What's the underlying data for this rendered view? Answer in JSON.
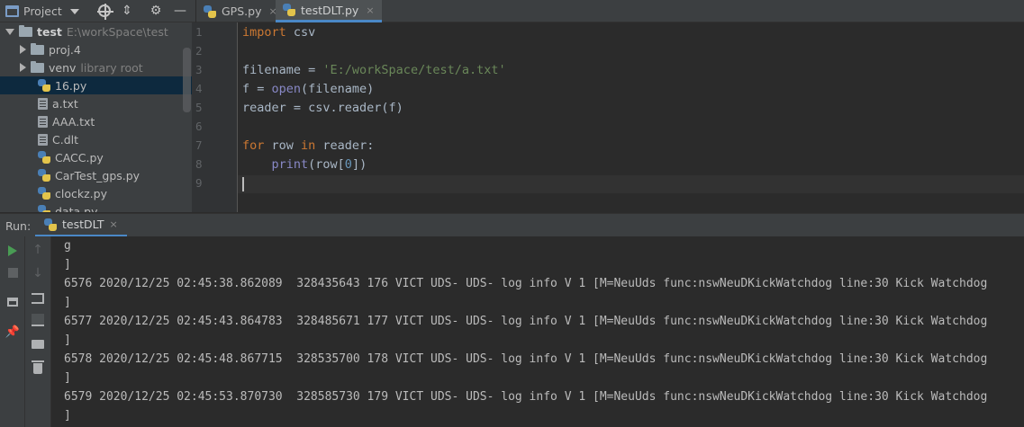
{
  "toolbar": {
    "project_label": "Project",
    "tabs": [
      {
        "label": "GPS.py",
        "close": "×"
      },
      {
        "label": "testDLT.py",
        "close": "×"
      }
    ]
  },
  "tree": {
    "root": {
      "name": "test",
      "path": "E:\\workSpace\\test"
    },
    "items": [
      {
        "name": "proj.4",
        "note": ""
      },
      {
        "name": "venv",
        "note": "library root"
      },
      {
        "name": "16.py",
        "note": ""
      },
      {
        "name": "a.txt",
        "note": ""
      },
      {
        "name": "AAA.txt",
        "note": ""
      },
      {
        "name": "C.dlt",
        "note": ""
      },
      {
        "name": "CACC.py",
        "note": ""
      },
      {
        "name": "CarTest_gps.py",
        "note": ""
      },
      {
        "name": "clockz.py",
        "note": ""
      },
      {
        "name": "data.py",
        "note": ""
      }
    ]
  },
  "editor": {
    "line_numbers": [
      "1",
      "2",
      "3",
      "4",
      "5",
      "6",
      "7",
      "8",
      "9"
    ],
    "code": {
      "l1_kw": "import",
      "l1_rest": " csv",
      "l3_lhs": "filename = ",
      "l3_str": "'E:/workSpace/test/a.txt'",
      "l4_lhs": "f = ",
      "l4_fn": "open",
      "l4_rest": "(filename)",
      "l5": "reader = csv.reader(f)",
      "l7_for": "for",
      "l7_mid": " row ",
      "l7_in": "in",
      "l7_rest": " reader:",
      "l8_indent": "    ",
      "l8_fn": "print",
      "l8_a": "(row[",
      "l8_num": "0",
      "l8_b": "])"
    }
  },
  "run": {
    "label": "Run:",
    "tab_label": "testDLT",
    "tab_close": "×",
    "console_lines": [
      "g",
      "]",
      "6576 2020/12/25 02:45:38.862089  328435643 176 VICT UDS- UDS- log info V 1 [M=NeuUds func:nswNeuDKickWatchdog line:30 Kick Watchdog",
      "]",
      "6577 2020/12/25 02:45:43.864783  328485671 177 VICT UDS- UDS- log info V 1 [M=NeuUds func:nswNeuDKickWatchdog line:30 Kick Watchdog",
      "]",
      "6578 2020/12/25 02:45:48.867715  328535700 178 VICT UDS- UDS- log info V 1 [M=NeuUds func:nswNeuDKickWatchdog line:30 Kick Watchdog",
      "]",
      "6579 2020/12/25 02:45:53.870730  328585730 179 VICT UDS- UDS- log info V 1 [M=NeuUds func:nswNeuDKickWatchdog line:30 Kick Watchdog",
      "]"
    ]
  },
  "colors": {
    "keyword": "#cc7832",
    "string": "#6a8759",
    "builtin": "#8888c6",
    "number": "#6897bb",
    "selection": "#0d293e",
    "tab_underline": "#4a88c7",
    "run_green": "#499c54"
  },
  "icons": [
    "project-window-icon",
    "crosshair-icon",
    "collapse-icon",
    "gear-icon",
    "minimize-icon",
    "python-file-icon",
    "text-file-icon",
    "folder-icon",
    "play-icon",
    "stop-icon",
    "layout-icon",
    "pin-icon",
    "up-arrow-icon",
    "down-arrow-icon",
    "soft-wrap-icon",
    "scroll-to-end-icon",
    "print-icon",
    "trash-icon"
  ]
}
